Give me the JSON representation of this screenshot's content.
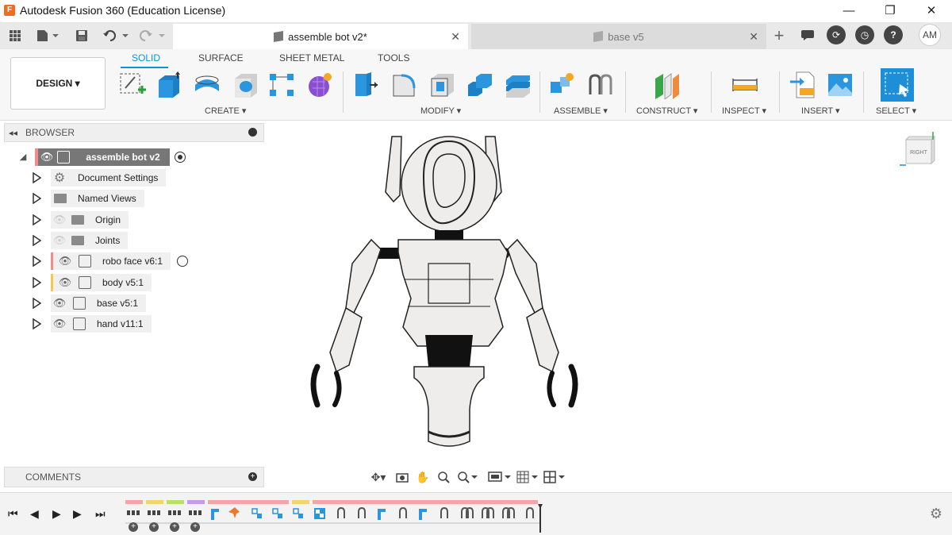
{
  "window": {
    "title": "Autodesk Fusion 360 (Education License)",
    "logo_letter": "F"
  },
  "tabs": [
    {
      "label": "assemble bot v2*",
      "active": true
    },
    {
      "label": "base v5",
      "active": false
    }
  ],
  "user_initials": "AM",
  "toolbar": {
    "design_label": "DESIGN ▾",
    "workspace_tabs": [
      "SOLID",
      "SURFACE",
      "SHEET METAL",
      "TOOLS"
    ],
    "groups": [
      "CREATE ▾",
      "MODIFY ▾",
      "ASSEMBLE ▾",
      "CONSTRUCT ▾",
      "INSPECT ▾",
      "INSERT ▾",
      "SELECT ▾"
    ]
  },
  "browser": {
    "title": "BROWSER",
    "root": "assemble bot v2",
    "items": [
      {
        "label": "Document Settings",
        "icon": "gear-icon"
      },
      {
        "label": "Named Views",
        "icon": "folder-icon"
      },
      {
        "label": "Origin",
        "icon": "folder-icon"
      },
      {
        "label": "Joints",
        "icon": "folder-icon"
      },
      {
        "label": "robo face v6:1",
        "icon": "component-icon",
        "color": "#f28b8b"
      },
      {
        "label": "body v5:1",
        "icon": "component-icon",
        "color": "#f2c94c"
      },
      {
        "label": "base v5:1",
        "icon": "component-icon"
      },
      {
        "label": "hand v11:1",
        "icon": "component-icon"
      }
    ]
  },
  "comments": {
    "title": "COMMENTS"
  },
  "viewcube": {
    "face_label": "RIGHT"
  },
  "colors": {
    "accent": "#0696d7",
    "root_marker": "#f28b8b"
  }
}
